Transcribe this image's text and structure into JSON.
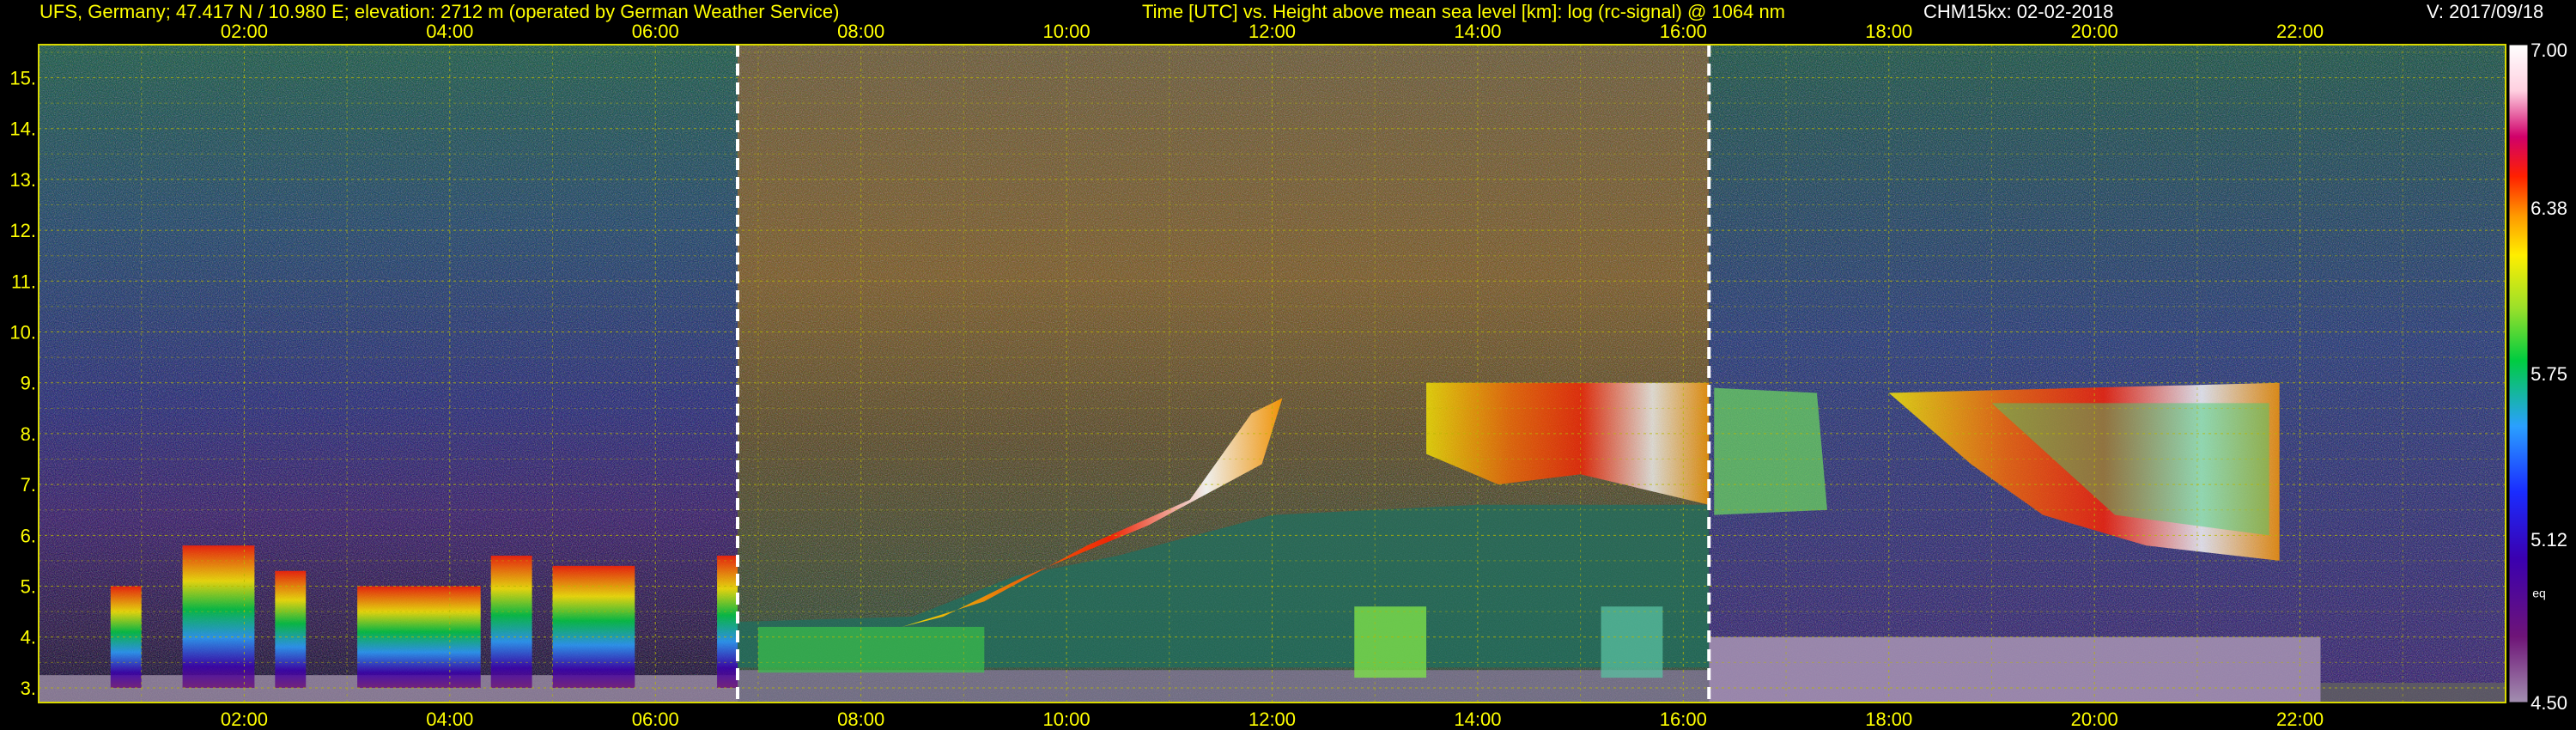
{
  "header": {
    "station": "UFS, Germany; 47.417 N / 10.980 E; elevation: 2712 m  (operated by German Weather Service)",
    "title": "Time [UTC] vs. Height above mean sea level [km]: log (rc-signal) @ 1064 nm",
    "instrument_date": "CHM15kx: 02-02-2018",
    "version": "V: 2017/09/18"
  },
  "colors": {
    "text": "#ffff00",
    "grid": "#b8b800",
    "background": "#000000",
    "marker": "#ffffff"
  },
  "chart_data": {
    "type": "heatmap",
    "title": "Time [UTC] vs. Height above mean sea level [km]: log (rc-signal) @ 1064 nm",
    "xlabel": "Time [UTC]",
    "ylabel": "Height above mean sea level [km]",
    "xlim": [
      0,
      24
    ],
    "ylim": [
      2.712,
      15.65
    ],
    "x_ticks": [
      "02:00",
      "04:00",
      "06:00",
      "08:00",
      "10:00",
      "12:00",
      "14:00",
      "16:00",
      "18:00",
      "20:00",
      "22:00"
    ],
    "x_tick_hours": [
      2,
      4,
      6,
      8,
      10,
      12,
      14,
      16,
      18,
      20,
      22
    ],
    "y_ticks": [
      "3.",
      "4.",
      "5.",
      "6.",
      "7.",
      "8.",
      "9.",
      "10.",
      "11.",
      "12.",
      "13.",
      "14.",
      "15."
    ],
    "y_tick_values": [
      3,
      4,
      5,
      6,
      7,
      8,
      9,
      10,
      11,
      12,
      13,
      14,
      15
    ],
    "dashed_markers_hours": [
      6.8,
      16.25
    ],
    "grid": true,
    "colorbar": {
      "min": 4.5,
      "max": 7.0,
      "labels": [
        "7.00",
        "6.38",
        "5.75",
        "5.12",
        "4.50"
      ],
      "label_values": [
        7.0,
        6.38,
        5.75,
        5.12,
        4.5
      ],
      "unit_text": "eq",
      "colors": [
        "#a28fb0",
        "#6e1477",
        "#3a00b0",
        "#1a2cff",
        "#2aa0ff",
        "#00cc40",
        "#9be02a",
        "#ffee00",
        "#ff9900",
        "#ff2000",
        "#d0006a",
        "#ffffff"
      ]
    }
  }
}
